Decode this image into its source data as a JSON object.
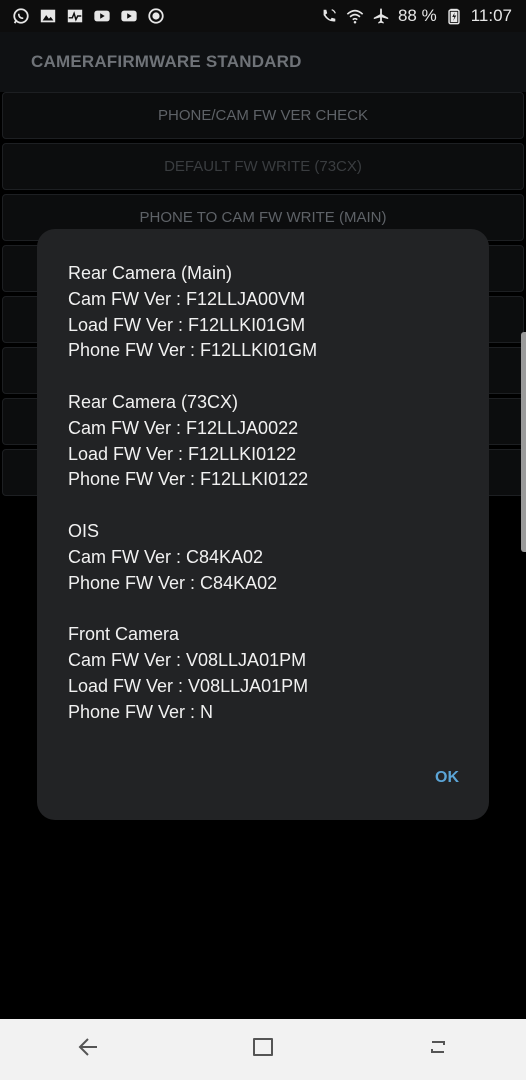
{
  "status_bar": {
    "left_icons": [
      "whatsapp-icon",
      "gallery-icon",
      "activity-icon",
      "youtube-icon",
      "youtube-icon",
      "record-icon"
    ],
    "right_icons": [
      "wifi-call-icon",
      "wifi-icon",
      "airplane-icon"
    ],
    "battery_percent": "88 %",
    "time": "11:07"
  },
  "app": {
    "title": "CAMERAFIRMWARE STANDARD",
    "buttons": [
      {
        "label": "PHONE/CAM FW VER CHECK",
        "enabled": true
      },
      {
        "label": "DEFAULT FW WRITE (73CX)",
        "enabled": false
      },
      {
        "label": "PHONE TO CAM FW WRITE (MAIN)",
        "enabled": true
      },
      {
        "label": "",
        "enabled": true
      },
      {
        "label": "",
        "enabled": true
      },
      {
        "label": "",
        "enabled": true
      },
      {
        "label": "",
        "enabled": true
      },
      {
        "label": "",
        "enabled": true
      }
    ]
  },
  "dialog": {
    "lines": [
      "Rear Camera (Main)",
      "Cam FW Ver : F12LLJA00VM",
      "Load FW Ver : F12LLKI01GM",
      "Phone FW Ver : F12LLKI01GM",
      "",
      "Rear Camera (73CX)",
      "Cam FW Ver : F12LLJA0022",
      "Load FW Ver : F12LLKI0122",
      "Phone FW Ver : F12LLKI0122",
      "",
      "OIS",
      "Cam FW Ver : C84KA02",
      "Phone FW Ver : C84KA02",
      "",
      "Front Camera",
      "Cam FW Ver : V08LLJA01PM",
      "Load FW Ver : V08LLJA01PM",
      "Phone FW Ver : N"
    ],
    "ok_label": "OK"
  },
  "nav_bar": {
    "buttons": [
      "back-icon",
      "home-icon",
      "recents-icon"
    ]
  },
  "colors": {
    "dialog_bg": "#222325",
    "accent": "#5ba4d6",
    "navbar_bg": "#f2f2f2"
  }
}
